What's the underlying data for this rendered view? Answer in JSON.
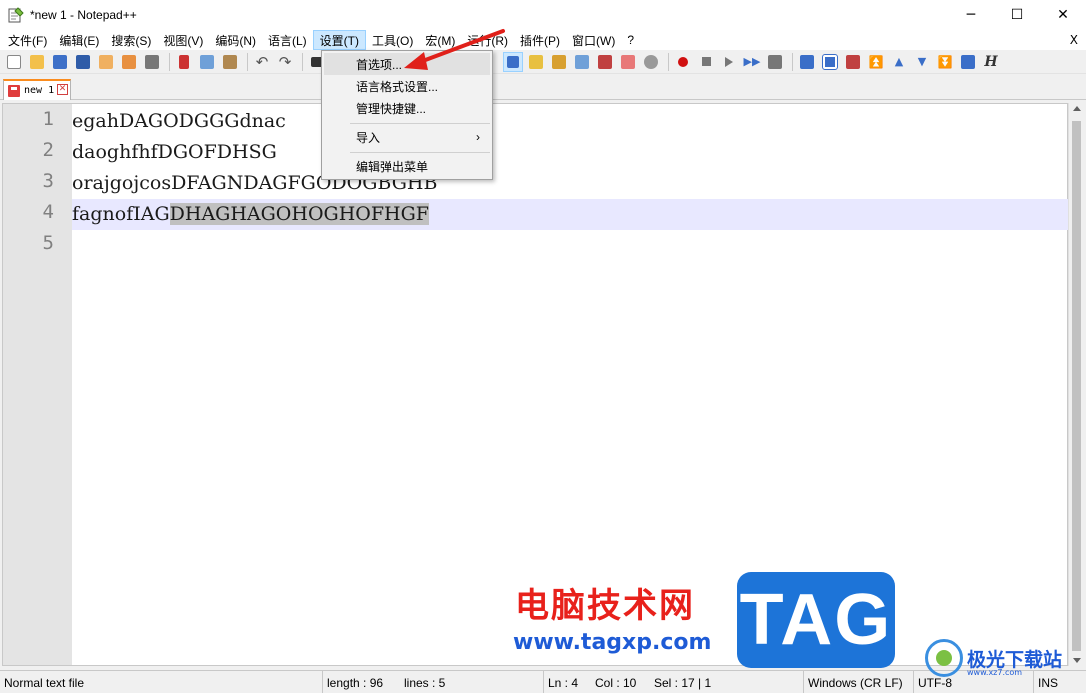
{
  "window": {
    "title": "*new 1 - Notepad++",
    "minimize_glyph": "─",
    "maximize_glyph": "☐",
    "close_glyph": "✕"
  },
  "menubar": {
    "items": [
      {
        "label": "文件(F)"
      },
      {
        "label": "编辑(E)"
      },
      {
        "label": "搜索(S)"
      },
      {
        "label": "视图(V)"
      },
      {
        "label": "编码(N)"
      },
      {
        "label": "语言(L)"
      },
      {
        "label": "设置(T)"
      },
      {
        "label": "工具(O)"
      },
      {
        "label": "宏(M)"
      },
      {
        "label": "运行(R)"
      },
      {
        "label": "插件(P)"
      },
      {
        "label": "窗口(W)"
      },
      {
        "label": "?"
      }
    ],
    "active_index": 6,
    "close_doc": "X"
  },
  "settings_menu": {
    "items": [
      {
        "label": "首选项..."
      },
      {
        "label": "语言格式设置..."
      },
      {
        "label": "管理快捷键..."
      },
      {
        "label": "导入",
        "submenu_arrow": "›"
      },
      {
        "label": "编辑弹出菜单"
      }
    ]
  },
  "tab": {
    "label": "new 1",
    "close_glyph": "✕"
  },
  "editor": {
    "lines": [
      {
        "num": "1",
        "text": "egahDAGODGGGdnac",
        "selected": ""
      },
      {
        "num": "2",
        "text": "daoghfhfDGOFDHSG",
        "selected": ""
      },
      {
        "num": "3",
        "text": "orajgojcosDFAGNDAGFGODOGBGHB",
        "selected": ""
      },
      {
        "num": "4",
        "text": "fagnofIAG",
        "selected": "DHAGHAGOHOGHOFHGF"
      },
      {
        "num": "5",
        "text": "",
        "selected": ""
      }
    ],
    "current_line": 4
  },
  "statusbar": {
    "file_type": "Normal text file",
    "length": "length : 96",
    "lines": "lines : 5",
    "ln": "Ln : 4",
    "col": "Col : 10",
    "sel": "Sel : 17 | 1",
    "eol": "Windows (CR LF)",
    "encoding": "UTF-8",
    "mode": "INS"
  },
  "watermark": {
    "site_name": "电脑技术网",
    "site_url": "www.tagxp.com",
    "tag": "TAG",
    "logo_text": "极光下载站",
    "logo_sub": "www.xz7.com"
  },
  "colors": {
    "menu_active_bg": "#cce8ff",
    "current_line_bg": "#e8e8ff",
    "selection_bg": "#c0c0c0",
    "annotation_arrow": "#e0201a",
    "tag_blue": "#1d74d8"
  },
  "icons": [
    "notepad-app-icon",
    "new-file-icon",
    "open-file-icon",
    "save-icon",
    "save-all-icon",
    "close-icon",
    "close-all-icon",
    "print-icon",
    "cut-icon",
    "copy-icon",
    "paste-icon",
    "undo-icon",
    "redo-icon",
    "find-icon",
    "wrap-icon",
    "indent-guide-icon",
    "macro-record-icon",
    "macro-stop-icon",
    "macro-play-icon",
    "macro-run-multiple-icon",
    "macro-save-icon"
  ]
}
